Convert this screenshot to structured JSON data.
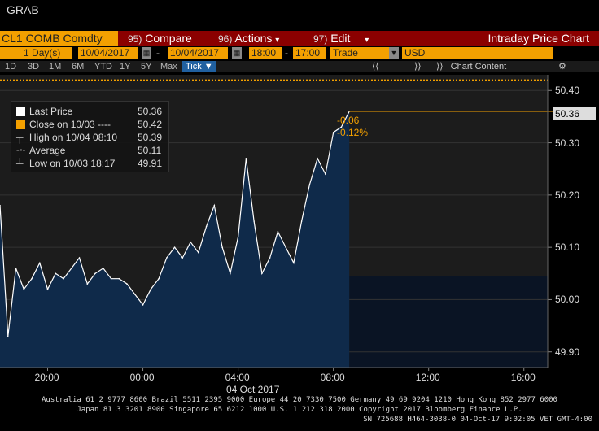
{
  "window": {
    "title": "GRAB"
  },
  "toolbar": {
    "ticker": "CL1 COMB Comdty",
    "compare_num": "95)",
    "compare_label": "Compare",
    "actions_num": "96)",
    "actions_label": "Actions",
    "edit_num": "97)",
    "edit_label": "Edit",
    "chart_title": "Intraday Price Chart"
  },
  "params": {
    "period_count": "1",
    "period_unit": "Day(s)",
    "start_date": "10/04/2017",
    "end_date": "10/04/2017",
    "start_time": "18:00",
    "end_time": "17:00",
    "event": "Trade",
    "currency": "USD"
  },
  "ranges": [
    "1D",
    "3D",
    "1M",
    "6M",
    "YTD",
    "1Y",
    "5Y",
    "Max"
  ],
  "active_range": "Tick ▼",
  "chart_content_label": "Chart Content",
  "legend": {
    "last_price_label": "Last Price",
    "last_price_value": "50.36",
    "close_label": "Close on 10/03 ----",
    "close_value": "50.42",
    "high_label": "High on 10/04 08:10",
    "high_value": "50.39",
    "average_label": "Average",
    "average_value": "50.11",
    "low_label": "Low on 10/03 18:17",
    "low_value": "49.91"
  },
  "change": {
    "abs": "-0.06",
    "pct": "-0.12%"
  },
  "colors": {
    "accent": "#f3a000",
    "toolbar": "#8b0000",
    "area": "#0f2a4a"
  },
  "chart_data": {
    "type": "area",
    "x_tick_labels": [
      "20:00",
      "00:00",
      "04:00",
      "08:00",
      "12:00",
      "16:00"
    ],
    "x_date_label": "04 Oct 2017",
    "y_tick_labels": [
      "50.40",
      "50.30",
      "50.20",
      "50.10",
      "50.00",
      "49.90"
    ],
    "ylim": [
      49.87,
      50.43
    ],
    "x": [
      "18:00",
      "18:20",
      "18:40",
      "19:00",
      "19:20",
      "19:40",
      "20:00",
      "20:20",
      "20:40",
      "21:00",
      "21:20",
      "21:40",
      "22:00",
      "22:20",
      "22:40",
      "23:00",
      "23:20",
      "23:40",
      "00:00",
      "00:20",
      "00:40",
      "01:00",
      "01:20",
      "01:40",
      "02:00",
      "02:20",
      "02:40",
      "03:00",
      "03:20",
      "03:40",
      "04:00",
      "04:20",
      "04:40",
      "05:00",
      "05:20",
      "05:40",
      "06:00",
      "06:20",
      "06:40",
      "07:00",
      "07:20",
      "07:40",
      "08:00",
      "08:20",
      "08:40"
    ],
    "values": [
      50.18,
      49.93,
      50.06,
      50.02,
      50.04,
      50.07,
      50.02,
      50.05,
      50.04,
      50.06,
      50.08,
      50.03,
      50.05,
      50.06,
      50.04,
      50.04,
      50.03,
      50.01,
      49.99,
      50.02,
      50.04,
      50.08,
      50.1,
      50.08,
      50.11,
      50.09,
      50.14,
      50.18,
      50.1,
      50.05,
      50.12,
      50.27,
      50.15,
      50.05,
      50.08,
      50.13,
      50.1,
      50.07,
      50.15,
      50.22,
      50.27,
      50.24,
      50.32,
      50.33,
      50.36
    ],
    "last_price": 50.36,
    "prev_close": 50.42,
    "high": 50.39,
    "average": 50.11,
    "low": 49.91
  },
  "axis_last_label": "50.36",
  "footer": {
    "line1": "Australia 61 2 9777 8600 Brazil 5511 2395 9000 Europe 44 20 7330 7500 Germany 49 69 9204 1210 Hong Kong 852 2977 6000",
    "line2": "Japan 81 3 3201 8900      Singapore 65 6212 1000      U.S. 1 212 318 2000         Copyright 2017 Bloomberg Finance L.P.",
    "line3": "SN 725688 H464-3038-0 04-Oct-17  9:02:05 VET  GMT-4:00"
  }
}
